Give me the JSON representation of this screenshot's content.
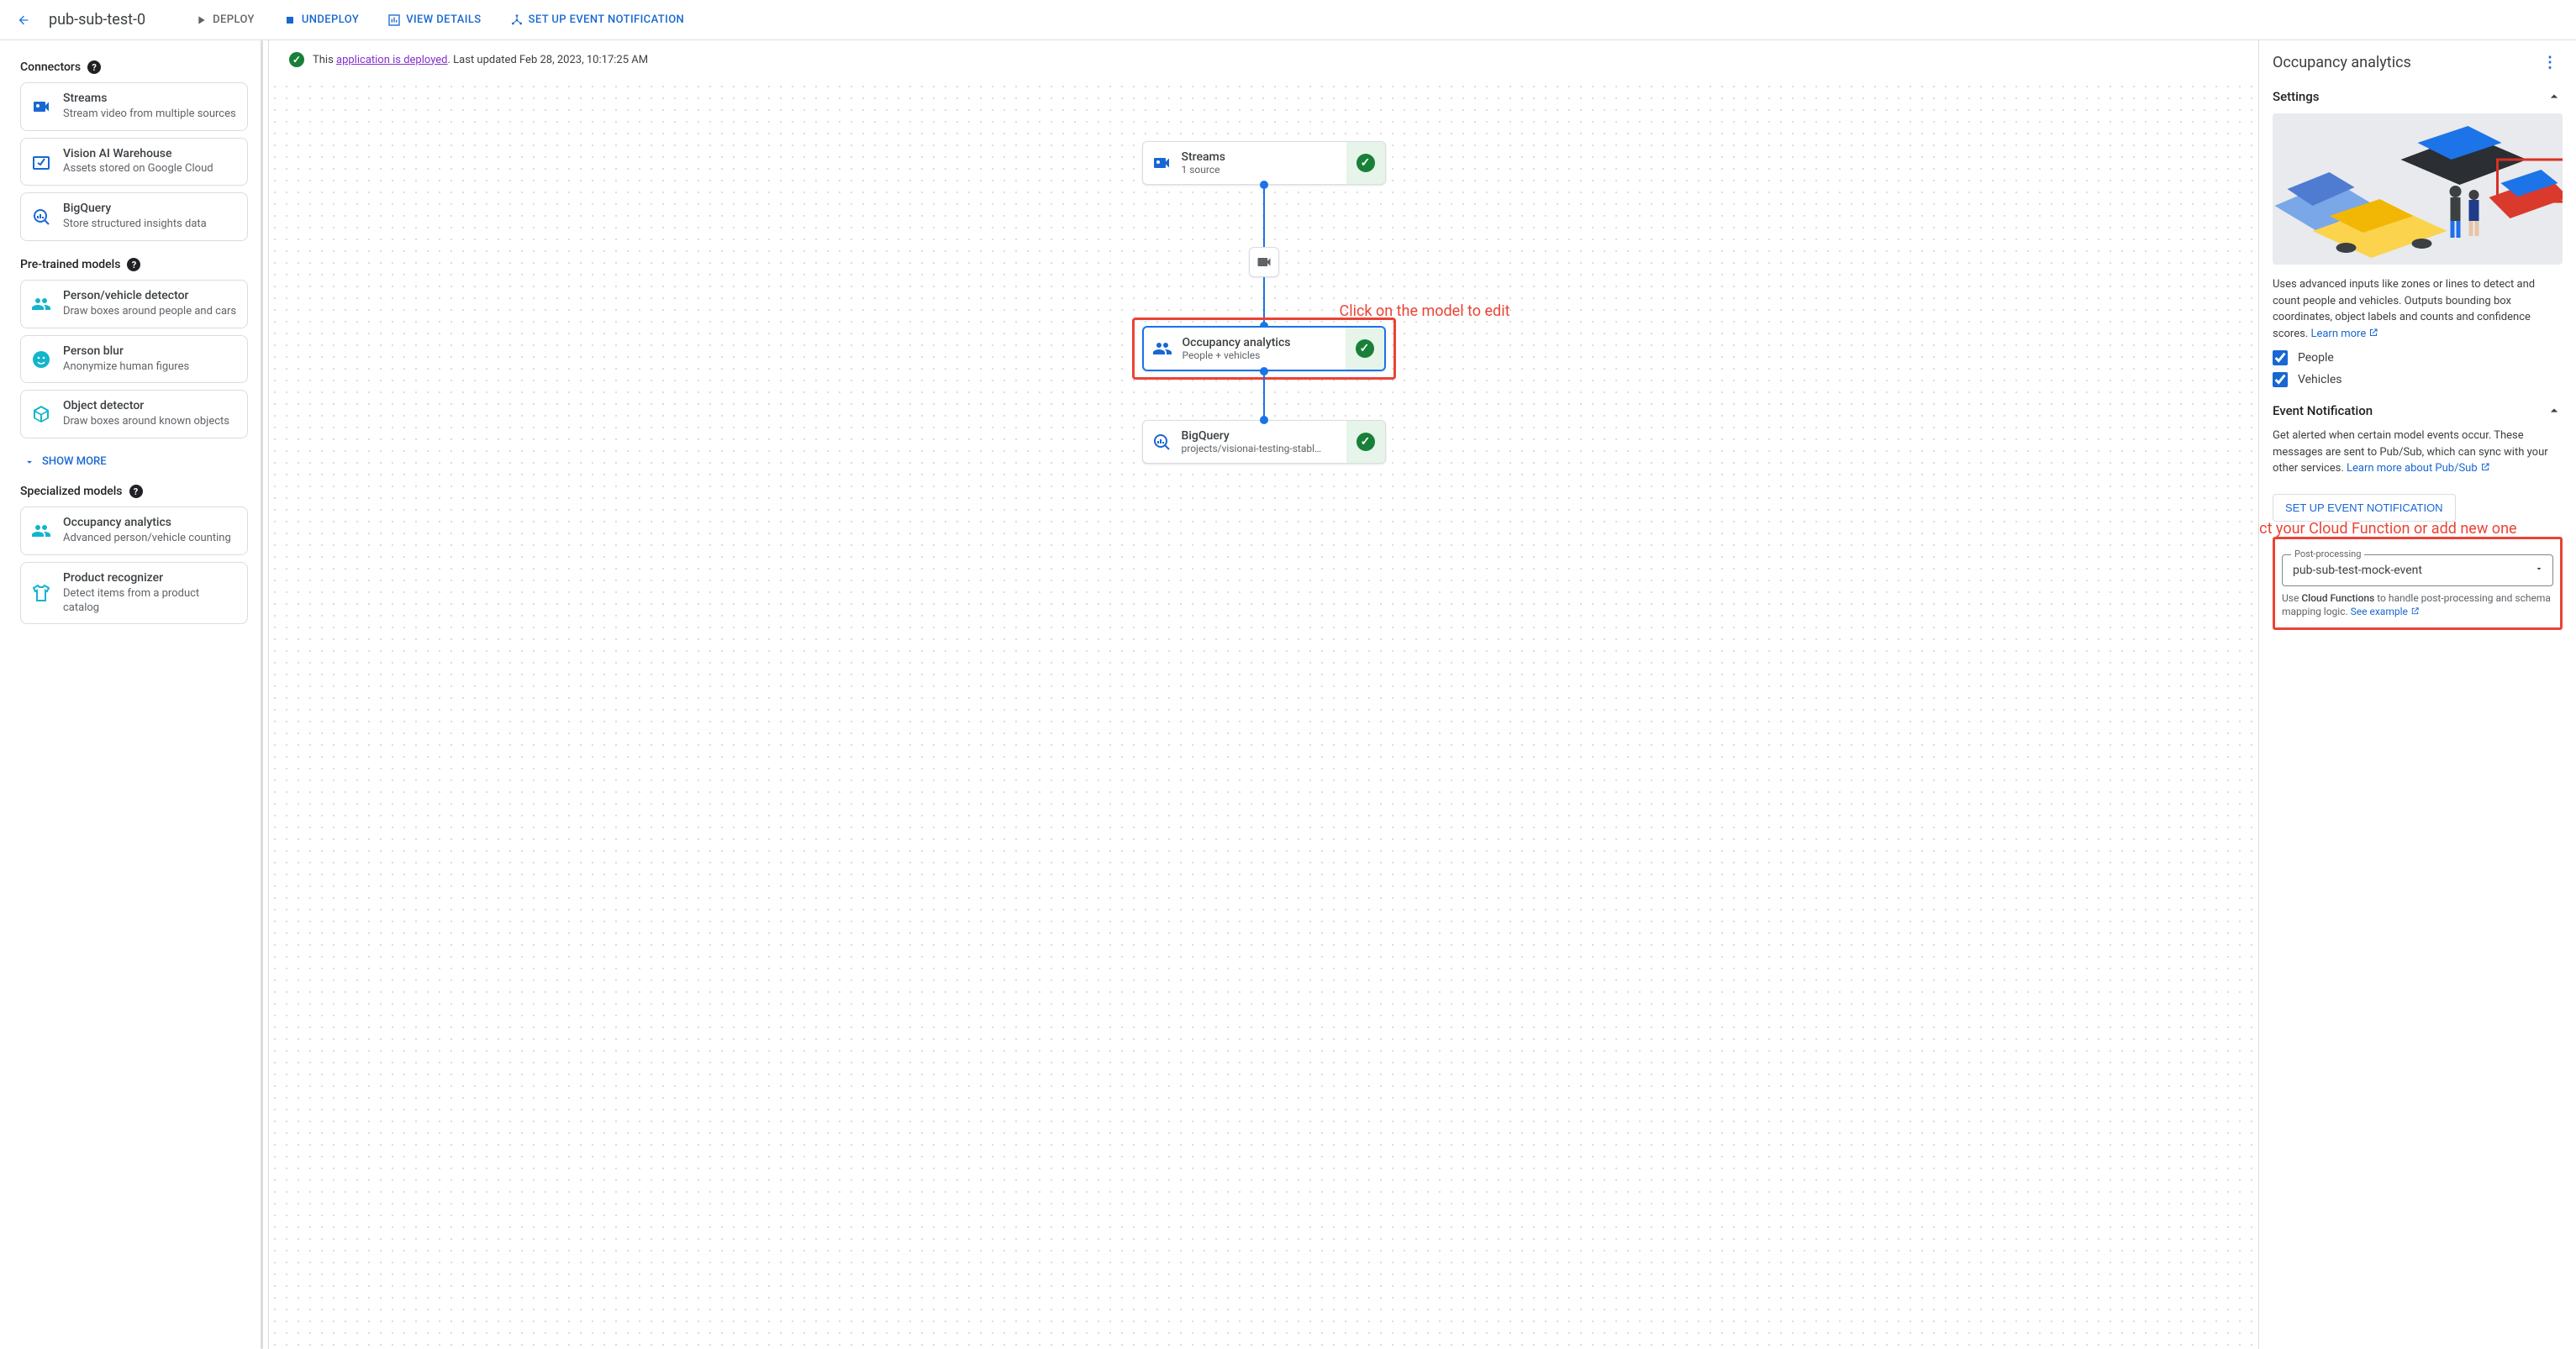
{
  "header": {
    "title": "pub-sub-test-0",
    "actions": {
      "deploy": "DEPLOY",
      "undeploy": "UNDEPLOY",
      "view_details": "VIEW DETAILS",
      "setup_event": "SET UP EVENT NOTIFICATION"
    }
  },
  "status": {
    "prefix": "This ",
    "link": "application is deployed",
    "suffix": ". Last updated Feb 28, 2023, 10:17:25 AM"
  },
  "sidebar": {
    "groups": {
      "connectors": {
        "title": "Connectors",
        "items": [
          {
            "title": "Streams",
            "sub": "Stream video from multiple sources",
            "icon": "camera"
          },
          {
            "title": "Vision AI Warehouse",
            "sub": "Assets stored on Google Cloud",
            "icon": "warehouse"
          },
          {
            "title": "BigQuery",
            "sub": "Store structured insights data",
            "icon": "bq"
          }
        ]
      },
      "pretrained": {
        "title": "Pre-trained models",
        "items": [
          {
            "title": "Person/vehicle detector",
            "sub": "Draw boxes around people and cars",
            "icon": "people",
            "tint": "teal"
          },
          {
            "title": "Person blur",
            "sub": "Anonymize human figures",
            "icon": "smile",
            "tint": "teal"
          },
          {
            "title": "Object detector",
            "sub": "Draw boxes around known objects",
            "icon": "cube",
            "tint": "teal"
          }
        ],
        "show_more": "SHOW MORE"
      },
      "specialized": {
        "title": "Specialized models",
        "items": [
          {
            "title": "Occupancy analytics",
            "sub": "Advanced person/vehicle counting",
            "icon": "people",
            "tint": "teal"
          },
          {
            "title": "Product recognizer",
            "sub": "Detect items from a product catalog",
            "icon": "shirt",
            "tint": "teal"
          }
        ]
      }
    }
  },
  "flow": {
    "n0": {
      "title": "Streams",
      "sub": "1 source"
    },
    "n1": {
      "title": "Occupancy analytics",
      "sub": "People + vehicles"
    },
    "n2": {
      "title": "BigQuery",
      "sub": "projects/visionai-testing-stabl…"
    }
  },
  "annotations": {
    "a1": "Click on the model to edit",
    "a2": "Select your Cloud Function or add new one"
  },
  "right": {
    "title": "Occupancy analytics",
    "settings": {
      "heading": "Settings",
      "desc": "Uses advanced inputs like zones or lines to detect and count people and vehicles. Outputs bounding box coordinates, object labels and counts and confidence scores. ",
      "learn": "Learn more",
      "cb_people": "People",
      "cb_vehicles": "Vehicles"
    },
    "event": {
      "heading": "Event Notification",
      "desc1": "Get alerted when certain model events occur. These messages are sent to Pub/Sub, which can sync with your other services. ",
      "learn": "Learn more about Pub/Sub",
      "button": "SET UP EVENT NOTIFICATION",
      "field_label": "Post-processing",
      "field_value": "pub-sub-test-mock-event",
      "hint1": "Use ",
      "hint_b": "Cloud Functions",
      "hint2": " to handle post-processing and schema mapping logic. ",
      "example": "See example"
    }
  }
}
